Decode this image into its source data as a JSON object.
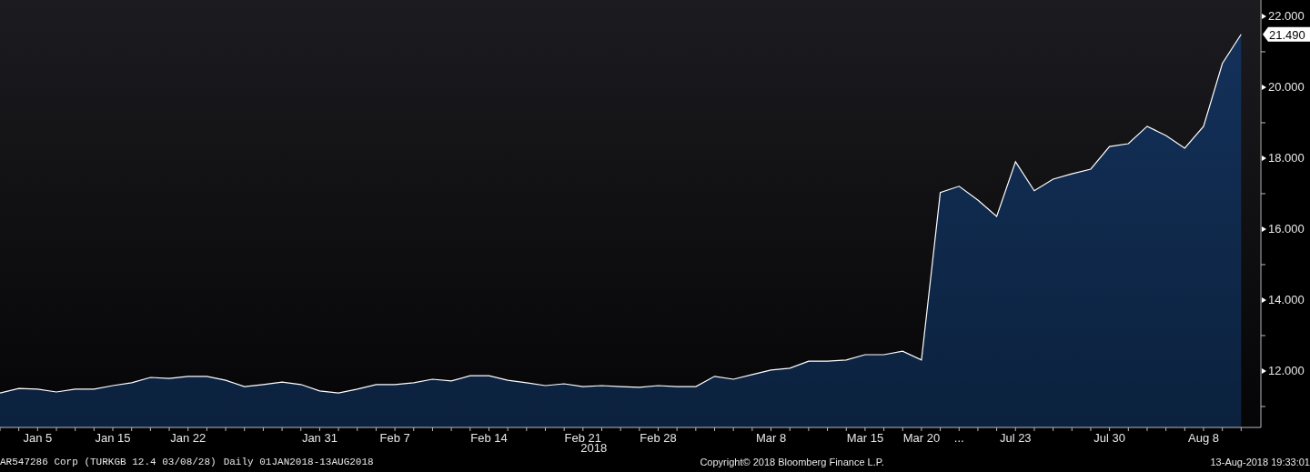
{
  "chart": {
    "last_price": "21.490",
    "year_label": "2018",
    "chart_data": {
      "type": "area",
      "categories": [
        null,
        null,
        "Jan 5",
        null,
        null,
        null,
        "Jan 15",
        null,
        null,
        null,
        "Jan 22",
        null,
        null,
        null,
        null,
        null,
        null,
        "Jan 31",
        null,
        null,
        null,
        "Feb 7",
        null,
        null,
        null,
        null,
        "Feb 14",
        null,
        null,
        null,
        null,
        "Feb 21",
        null,
        null,
        null,
        "Feb 28",
        null,
        null,
        null,
        null,
        null,
        "Mar 8",
        null,
        null,
        null,
        null,
        "Mar 15",
        null,
        null,
        "Mar 20",
        null,
        "...",
        null,
        null,
        "Jul 23",
        null,
        null,
        null,
        null,
        "Jul 30",
        null,
        null,
        null,
        null,
        "Aug 8",
        null,
        null
      ],
      "series": [
        {
          "color": "#ffffff",
          "values": [
            11.38,
            11.51,
            11.49,
            11.41,
            11.49,
            11.49,
            11.59,
            11.67,
            11.82,
            11.79,
            11.85,
            11.85,
            11.74,
            11.56,
            11.62,
            11.69,
            11.62,
            11.44,
            11.38,
            11.49,
            11.62,
            11.62,
            11.67,
            11.77,
            11.72,
            11.87,
            11.87,
            11.74,
            11.67,
            11.59,
            11.64,
            11.56,
            11.59,
            11.56,
            11.54,
            11.59,
            11.56,
            11.56,
            11.85,
            11.77,
            11.9,
            12.03,
            12.08,
            12.28,
            12.28,
            12.31,
            12.46,
            12.46,
            12.56,
            12.31,
            17.03,
            17.21,
            16.82,
            16.36,
            17.9,
            17.08,
            17.41,
            17.56,
            17.69,
            18.33,
            18.41,
            18.9,
            18.64,
            18.28,
            18.9,
            20.67,
            21.49
          ]
        }
      ],
      "ylim": [
        10.41,
        22.46
      ],
      "yticks": [
        {
          "value": 12,
          "label": "12.000"
        },
        {
          "value": 14,
          "label": "14.000"
        },
        {
          "value": 16,
          "label": "16.000"
        },
        {
          "value": 18,
          "label": "18.000"
        },
        {
          "value": 20,
          "label": "20.000"
        },
        {
          "value": 22,
          "label": "22.000"
        }
      ]
    }
  },
  "footer": {
    "security": "AR547286 Corp (TURKGB 12.4 03/08/28)",
    "range": "Daily 01JAN2018-13AUG2018",
    "copyright": "Copyright© 2018 Bloomberg Finance L.P.",
    "timestamp": "13-Aug-2018 19:33:01"
  }
}
